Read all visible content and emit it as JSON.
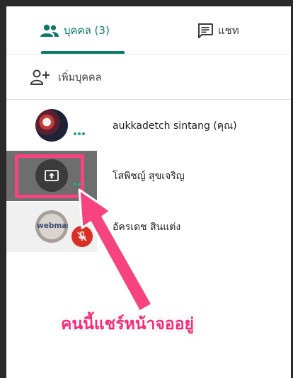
{
  "tabs": {
    "people_label": "บุคคล (3)",
    "chat_label": "แชท",
    "people_icon": "people-icon",
    "chat_icon": "chat-icon",
    "accent": "#0b7a6b"
  },
  "add_people": {
    "label": "เพิ่มบุคคล",
    "icon": "add-person-icon"
  },
  "participants": [
    {
      "name": "aukkadetch sintang (คุณ)",
      "status": "speaking-dots"
    },
    {
      "name": "โสพิชญ์ สุขเจริญ",
      "status": "presenting",
      "icon": "present-screen-icon"
    },
    {
      "name": "อัครเดช สินแต่ง",
      "status": "muted",
      "icon": "mic-off-icon",
      "avatar_text": "webmaster"
    }
  ],
  "annotation": {
    "caption": "คนนี้แชร์หน้าจออยู่",
    "color": "#f72a78"
  }
}
